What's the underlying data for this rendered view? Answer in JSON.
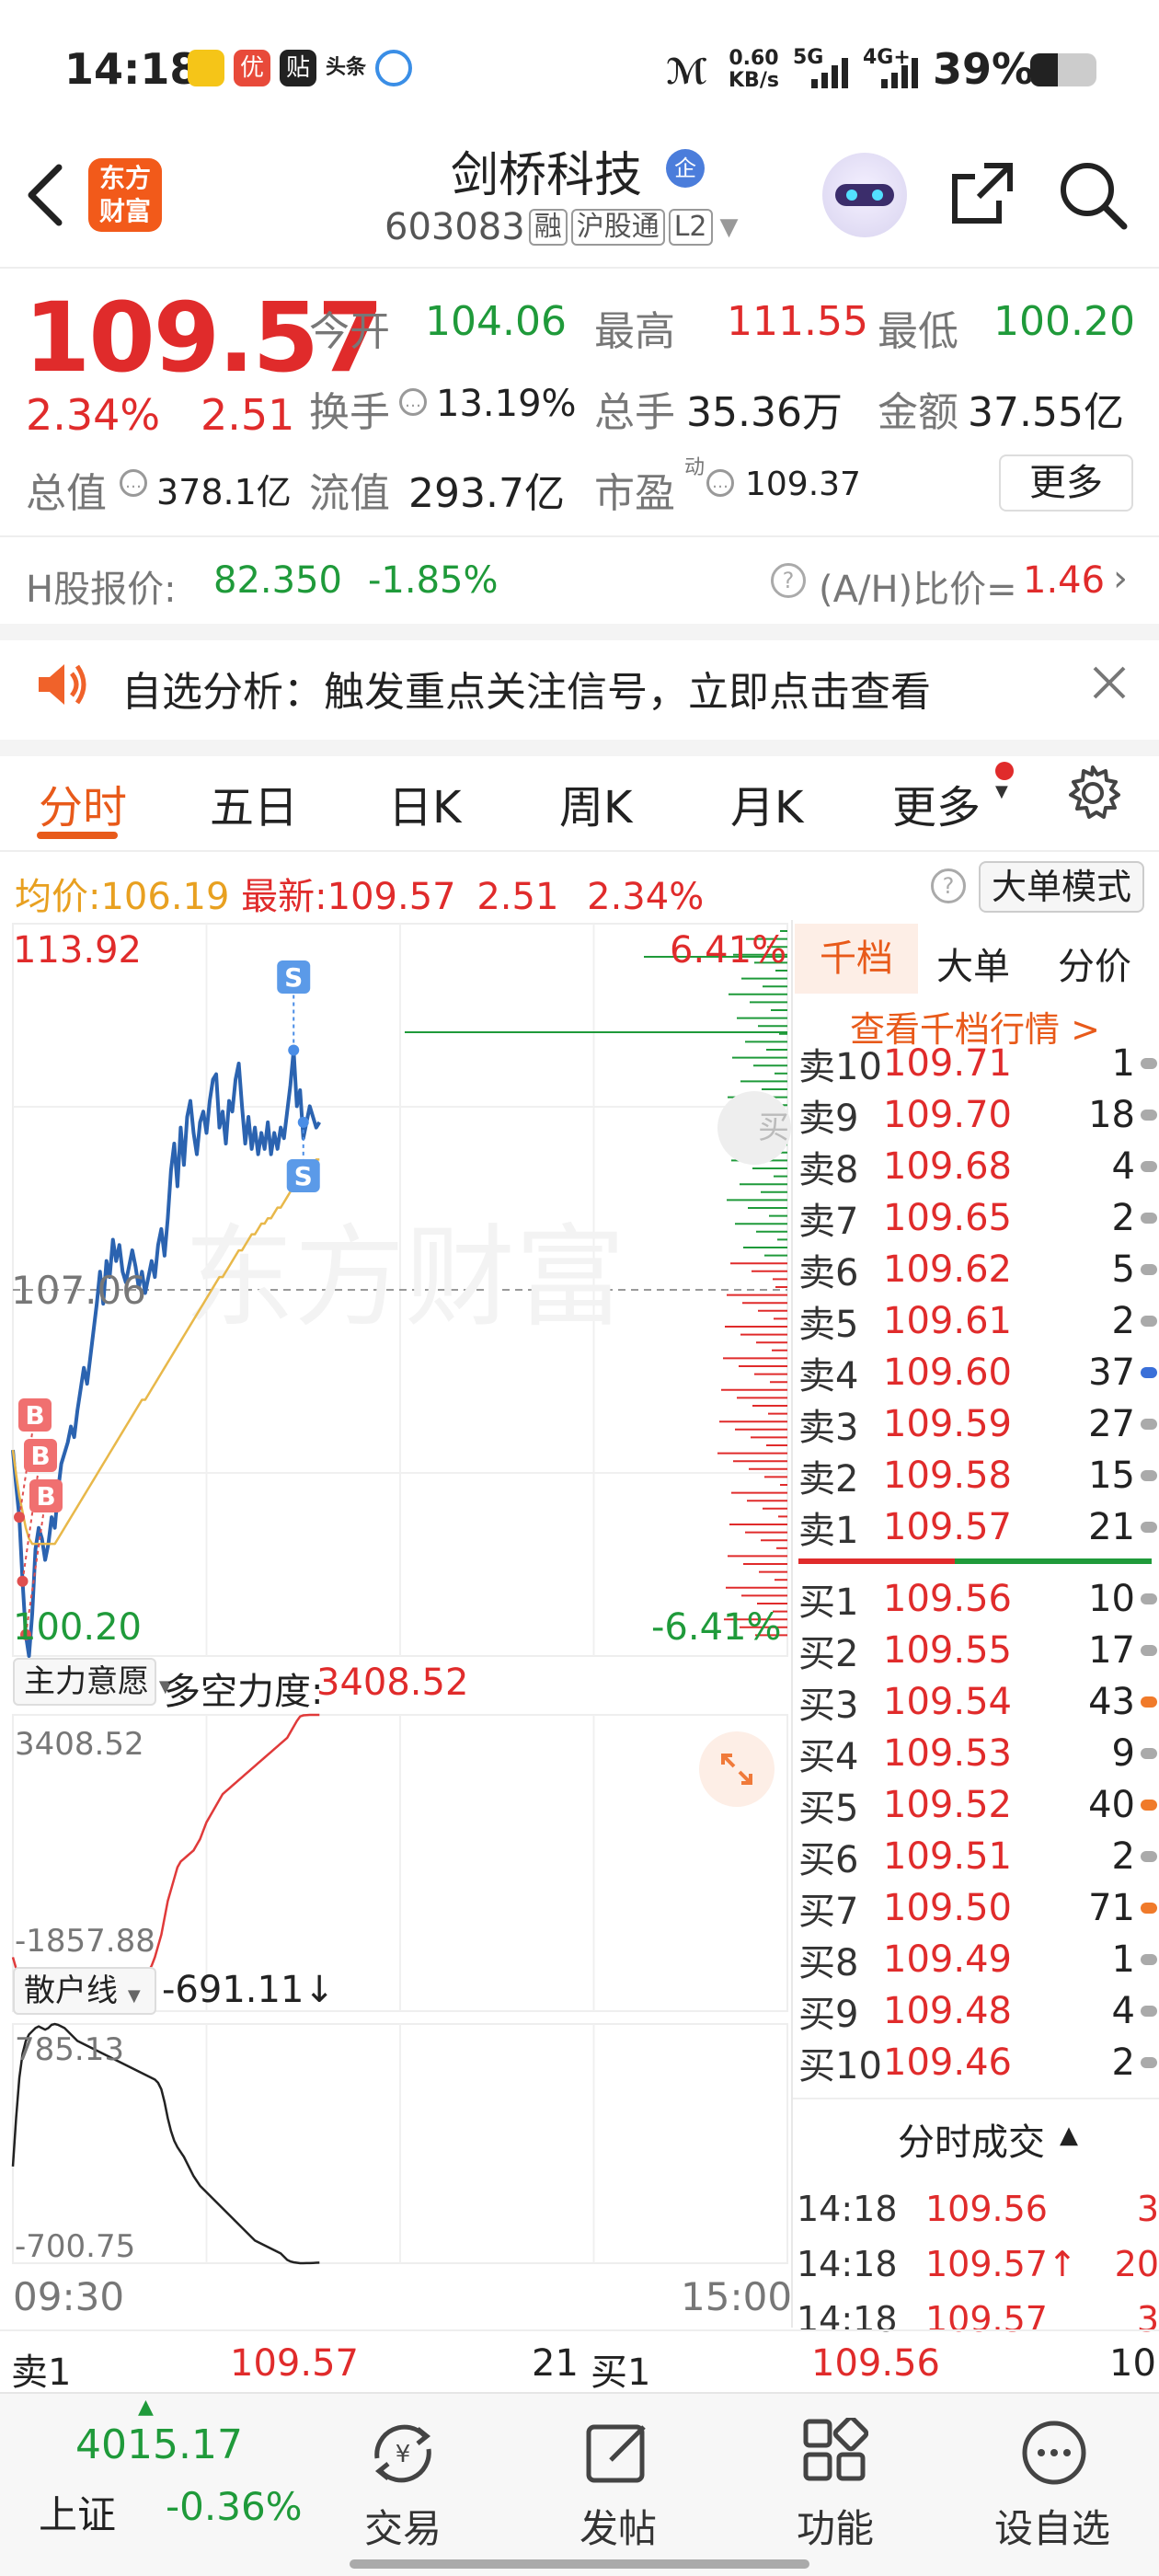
{
  "status_bar": {
    "time": "14:18",
    "speed_value": "0.60",
    "speed_unit": "KB/s",
    "net1": "5G",
    "net2": "4G+",
    "battery": "39%"
  },
  "header": {
    "logo_line1": "东方",
    "logo_line2": "财富",
    "stock_name": "剑桥科技",
    "badge": "企",
    "code": "603083",
    "tags": [
      "融",
      "沪股通",
      "L2"
    ]
  },
  "quote": {
    "price": "109.57",
    "change_pct": "2.34%",
    "change_amt": "2.51",
    "open_label": "今开",
    "open": "104.06",
    "high_label": "最高",
    "high": "111.55",
    "low_label": "最低",
    "low": "100.20",
    "turnover_label": "换手",
    "turnover": "13.19%",
    "volume_label": "总手",
    "volume": "35.36万",
    "amount_label": "金额",
    "amount": "37.55亿",
    "total_cap_label": "总值",
    "total_cap": "378.1亿",
    "float_cap_label": "流值",
    "float_cap": "293.7亿",
    "pe_label": "市盈",
    "pe_mark": "动",
    "pe": "109.37",
    "more_label": "更多"
  },
  "h_share": {
    "label": "H股报价:",
    "price": "82.350",
    "change": "-1.85%",
    "ratio_label": "(A/H)比价=",
    "ratio": "1.46"
  },
  "alert": {
    "text": "自选分析：触发重点关注信号，立即点击查看"
  },
  "tabs": [
    "分时",
    "五日",
    "日K",
    "周K",
    "月K",
    "更多"
  ],
  "chart_header": {
    "avg_label": "均价:",
    "avg": "106.19",
    "latest_label": " 最新:",
    "latest": "109.57",
    "change": "2.51",
    "change_pct": "2.34%",
    "mode_button": "大单模式"
  },
  "chart_data": {
    "type": "line",
    "price_axis_labels": {
      "max": "113.92",
      "mid": "107.06",
      "min": "100.20"
    },
    "pct_axis_labels": {
      "max": "6.41%",
      "min": "-6.41%"
    },
    "ylim": [
      100.2,
      113.92
    ],
    "prev_close": 107.06,
    "time_labels": {
      "start": "09:30",
      "end": "15:00"
    },
    "float_button": "买",
    "series": [
      {
        "color": "#2b63b0",
        "values": [
          104.06,
          103.4,
          102.8,
          101.6,
          100.6,
          100.2,
          101.0,
          102.2,
          102.6,
          102.4,
          102.0,
          102.3,
          102.8,
          102.6,
          103.3,
          103.8,
          104.0,
          104.2,
          104.5,
          104.3,
          104.8,
          105.2,
          105.6,
          105.3,
          105.8,
          106.3,
          106.8,
          107.4,
          106.8,
          107.6,
          107.3,
          108.0,
          107.6,
          107.9,
          107.4,
          107.2,
          107.5,
          107.8,
          107.5,
          107.1,
          107.4,
          107.0,
          107.3,
          107.6,
          107.3,
          107.9,
          108.2,
          107.7,
          108.4,
          109.3,
          109.8,
          109.0,
          110.1,
          109.4,
          110.3,
          110.6,
          110.0,
          109.6,
          110.2,
          110.4,
          110.0,
          110.6,
          111.0,
          111.1,
          110.1,
          110.4,
          109.8,
          110.6,
          110.4,
          111.0,
          111.3,
          110.5,
          109.8,
          110.3,
          109.7,
          110.1,
          109.6,
          110.0,
          109.7,
          110.2,
          109.6,
          110.0,
          109.7,
          110.1,
          109.9,
          110.4,
          110.9,
          111.55,
          110.5,
          110.8,
          109.9,
          110.2,
          110.5,
          110.3,
          110.1,
          110.2
        ]
      },
      {
        "color": "#e8b84a",
        "values": [
          104.06,
          103.6,
          103.2,
          102.9,
          102.6,
          102.4,
          102.3,
          102.3,
          102.3,
          102.3,
          102.3,
          102.3,
          102.3,
          102.3,
          102.4,
          102.5,
          102.6,
          102.7,
          102.8,
          102.9,
          103.0,
          103.1,
          103.2,
          103.3,
          103.4,
          103.5,
          103.6,
          103.7,
          103.8,
          103.9,
          104.0,
          104.1,
          104.2,
          104.3,
          104.4,
          104.5,
          104.6,
          104.7,
          104.8,
          104.9,
          105.0,
          105.0,
          105.1,
          105.2,
          105.3,
          105.4,
          105.5,
          105.6,
          105.7,
          105.8,
          105.9,
          106.0,
          106.1,
          106.2,
          106.3,
          106.4,
          106.5,
          106.6,
          106.7,
          106.8,
          106.9,
          107.0,
          107.1,
          107.2,
          107.3,
          107.3,
          107.4,
          107.5,
          107.6,
          107.7,
          107.8,
          107.8,
          107.9,
          108.0,
          108.1,
          108.1,
          108.2,
          108.3,
          108.3,
          108.4,
          108.4,
          108.5,
          108.6,
          108.6,
          108.7,
          108.8,
          108.9,
          109.0,
          109.1,
          109.2,
          109.3,
          109.3,
          109.4,
          109.4,
          109.5,
          109.5
        ]
      }
    ],
    "markers": [
      {
        "label": "B",
        "index": 2,
        "value": 102.8
      },
      {
        "label": "B",
        "index": 3,
        "value": 101.6
      },
      {
        "label": "B",
        "index": 4,
        "value": 100.6
      },
      {
        "label": "S",
        "index": 87,
        "value": 111.55
      },
      {
        "label": "S",
        "index": 90,
        "value": 110.2
      }
    ]
  },
  "sub_chart1": {
    "selector": "主力意愿",
    "label": "多空力度:",
    "value": "3408.52",
    "axis_max": "3408.52",
    "axis_min": "-1857.88",
    "ylim": [
      -1857.88,
      3408.52
    ],
    "values": [
      -900,
      -1100,
      -1300,
      -1500,
      -1650,
      -1750,
      -1810,
      -1840,
      -1857.88,
      -1840,
      -1800,
      -1760,
      -1720,
      -1690,
      -1650,
      -1620,
      -1600,
      -1570,
      -1550,
      -1530,
      -1500,
      -1480,
      -1460,
      -1440,
      -1420,
      -1400,
      -1380,
      -1360,
      -1360,
      -1350,
      -1340,
      -1320,
      -1300,
      -1310,
      -1290,
      -1280,
      -1260,
      -1250,
      -1240,
      -1230,
      -1220,
      -1200,
      -1150,
      -1050,
      -900,
      -700,
      -500,
      -200,
      100,
      300,
      500,
      700,
      800,
      850,
      900,
      950,
      1000,
      1100,
      1200,
      1350,
      1500,
      1600,
      1700,
      1800,
      1900,
      2000,
      2050,
      2100,
      2150,
      2200,
      2250,
      2300,
      2350,
      2400,
      2450,
      2500,
      2550,
      2600,
      2650,
      2700,
      2750,
      2800,
      2850,
      2900,
      2950,
      3000,
      3100,
      3200,
      3300,
      3380,
      3400,
      3405,
      3408,
      3408.52,
      3408.52,
      3408.52
    ]
  },
  "sub_chart2": {
    "selector": "散户线",
    "value": "-691.11↓",
    "axis_max": "785.13",
    "axis_min": "-700.75",
    "ylim": [
      -700.75,
      785.13
    ],
    "values": [
      -100,
      200,
      450,
      600,
      680,
      720,
      740,
      760,
      770,
      760,
      750,
      760,
      780,
      785.13,
      780,
      770,
      760,
      740,
      720,
      700,
      680,
      670,
      660,
      650,
      640,
      630,
      620,
      610,
      600,
      590,
      580,
      570,
      560,
      550,
      540,
      530,
      520,
      510,
      500,
      490,
      480,
      470,
      460,
      450,
      440,
      420,
      380,
      300,
      200,
      120,
      60,
      20,
      -10,
      -40,
      -80,
      -120,
      -160,
      -190,
      -220,
      -240,
      -260,
      -280,
      -300,
      -320,
      -340,
      -360,
      -380,
      -400,
      -420,
      -440,
      -460,
      -480,
      -500,
      -520,
      -540,
      -560,
      -570,
      -580,
      -590,
      -600,
      -610,
      -620,
      -630,
      -640,
      -660,
      -680,
      -690,
      -695,
      -698,
      -700.75,
      -700.5,
      -700.2,
      -700,
      -699,
      -698,
      -697
    ]
  },
  "order_book": {
    "tabs": [
      "千档",
      "大单",
      "分价"
    ],
    "link": "查看千档行情 >",
    "asks": [
      {
        "label": "卖10",
        "price": "109.71",
        "qty": "1",
        "dot": "#aaa"
      },
      {
        "label": "卖9",
        "price": "109.70",
        "qty": "18",
        "dot": "#aaa"
      },
      {
        "label": "卖8",
        "price": "109.68",
        "qty": "4",
        "dot": "#aaa"
      },
      {
        "label": "卖7",
        "price": "109.65",
        "qty": "2",
        "dot": "#aaa"
      },
      {
        "label": "卖6",
        "price": "109.62",
        "qty": "5",
        "dot": "#aaa"
      },
      {
        "label": "卖5",
        "price": "109.61",
        "qty": "2",
        "dot": "#aaa"
      },
      {
        "label": "卖4",
        "price": "109.60",
        "qty": "37",
        "dot": "#3a6fd8"
      },
      {
        "label": "卖3",
        "price": "109.59",
        "qty": "27",
        "dot": "#aaa"
      },
      {
        "label": "卖2",
        "price": "109.58",
        "qty": "15",
        "dot": "#aaa"
      },
      {
        "label": "卖1",
        "price": "109.57",
        "qty": "21",
        "dot": "#aaa"
      }
    ],
    "bids": [
      {
        "label": "买1",
        "price": "109.56",
        "qty": "10",
        "dot": "#aaa"
      },
      {
        "label": "买2",
        "price": "109.55",
        "qty": "17",
        "dot": "#aaa"
      },
      {
        "label": "买3",
        "price": "109.54",
        "qty": "43",
        "dot": "#f07a2a"
      },
      {
        "label": "买4",
        "price": "109.53",
        "qty": "9",
        "dot": "#aaa"
      },
      {
        "label": "买5",
        "price": "109.52",
        "qty": "40",
        "dot": "#f07a2a"
      },
      {
        "label": "买6",
        "price": "109.51",
        "qty": "2",
        "dot": "#aaa"
      },
      {
        "label": "买7",
        "price": "109.50",
        "qty": "71",
        "dot": "#f07a2a"
      },
      {
        "label": "买8",
        "price": "109.49",
        "qty": "1",
        "dot": "#aaa"
      },
      {
        "label": "买9",
        "price": "109.48",
        "qty": "4",
        "dot": "#aaa"
      },
      {
        "label": "买10",
        "price": "109.46",
        "qty": "2",
        "dot": "#aaa"
      }
    ]
  },
  "ticks": {
    "header": "分时成交",
    "rows": [
      {
        "time": "14:18",
        "price": "109.56",
        "vol": "3"
      },
      {
        "time": "14:18",
        "price": "109.57↑",
        "vol": "20"
      },
      {
        "time": "14:18",
        "price": "109.57",
        "vol": "3"
      }
    ]
  },
  "strip": {
    "sell_label": "卖1",
    "sell_price": "109.57",
    "sell_qty": "21",
    "buy_label": "买1",
    "buy_price": "109.56",
    "buy_qty": "10"
  },
  "bottom_nav": {
    "index": {
      "value": "4015.17",
      "name": "上证",
      "change": "-0.36%"
    },
    "items": [
      "交易",
      "发帖",
      "功能",
      "设自选"
    ]
  }
}
